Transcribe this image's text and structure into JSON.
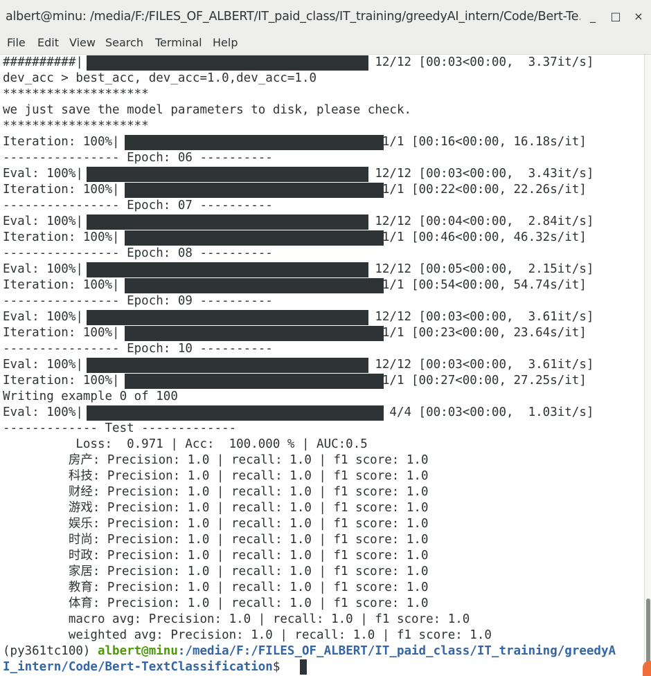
{
  "window": {
    "title": "albert@minu: /media/F:/FILES_OF_ALBERT/IT_paid_class/IT_training/greedyAI_intern/Code/Bert-Te…",
    "minimize": "_",
    "maximize": "□",
    "close": "×"
  },
  "menu": [
    "File",
    "Edit",
    "View",
    "Search",
    "Terminal",
    "Help"
  ],
  "lines": [
    "##########|                                      | 12/12 [00:03<00:00,  3.37it/s]",
    "dev_acc > best_acc, dev_acc=1.0,dev_acc=1.0",
    "********************",
    "we just save the model parameters to disk, please check.",
    "********************",
    "Iteration: 100%|                                  | 1/1 [00:16<00:00, 16.18s/it]",
    "---------------- Epoch: 06 ----------",
    "Eval: 100%|                                      | 12/12 [00:03<00:00,  3.43it/s]",
    "Iteration: 100%|                                  | 1/1 [00:22<00:00, 22.26s/it]",
    "---------------- Epoch: 07 ----------",
    "Eval: 100%|                                      | 12/12 [00:04<00:00,  2.84it/s]",
    "Iteration: 100%|                                  | 1/1 [00:46<00:00, 46.32s/it]",
    "---------------- Epoch: 08 ----------",
    "Eval: 100%|                                      | 12/12 [00:05<00:00,  2.15it/s]",
    "Iteration: 100%|                                  | 1/1 [00:54<00:00, 54.74s/it]",
    "---------------- Epoch: 09 ----------",
    "Eval: 100%|                                      | 12/12 [00:03<00:00,  3.61it/s]",
    "Iteration: 100%|                                  | 1/1 [00:23<00:00, 23.64s/it]",
    "---------------- Epoch: 10 ----------",
    "Eval: 100%|                                      | 12/12 [00:03<00:00,  3.61it/s]",
    "Iteration: 100%|                                  | 1/1 [00:27<00:00, 27.25s/it]",
    "Writing example 0 of 100",
    "Eval: 100%|                                        | 4/4 [00:03<00:00,  1.03it/s]",
    "------------- Test -------------",
    "          Loss:  0.971 | Acc:  100.000 % | AUC:0.5",
    "         房产: Precision: 1.0 | recall: 1.0 | f1 score: 1.0",
    "         科技: Precision: 1.0 | recall: 1.0 | f1 score: 1.0",
    "         财经: Precision: 1.0 | recall: 1.0 | f1 score: 1.0",
    "         游戏: Precision: 1.0 | recall: 1.0 | f1 score: 1.0",
    "         娱乐: Precision: 1.0 | recall: 1.0 | f1 score: 1.0",
    "         时尚: Precision: 1.0 | recall: 1.0 | f1 score: 1.0",
    "         时政: Precision: 1.0 | recall: 1.0 | f1 score: 1.0",
    "         家居: Precision: 1.0 | recall: 1.0 | f1 score: 1.0",
    "         教育: Precision: 1.0 | recall: 1.0 | f1 score: 1.0",
    "         体育: Precision: 1.0 | recall: 1.0 | f1 score: 1.0",
    "         macro avg: Precision: 1.0 | recall: 1.0 | f1 score: 1.0",
    "         weighted avg: Precision: 1.0 | recall: 1.0 | f1 score: 1.0"
  ],
  "prompt": {
    "env": "(py361tc100) ",
    "user_host": "albert@minu",
    "path_line1": ":/media/F:/FILES_OF_ALBERT/IT_paid_class/IT_training/greedyA",
    "path_line2": "I_intern/Code/Bert-TextClassification",
    "symbol": "$ "
  },
  "colors": {
    "text": "#2e3436",
    "progress_fill": "#2e3436",
    "prompt_user": "#4e9a06",
    "prompt_path": "#3465a4",
    "chrome": "#eeeeec"
  }
}
